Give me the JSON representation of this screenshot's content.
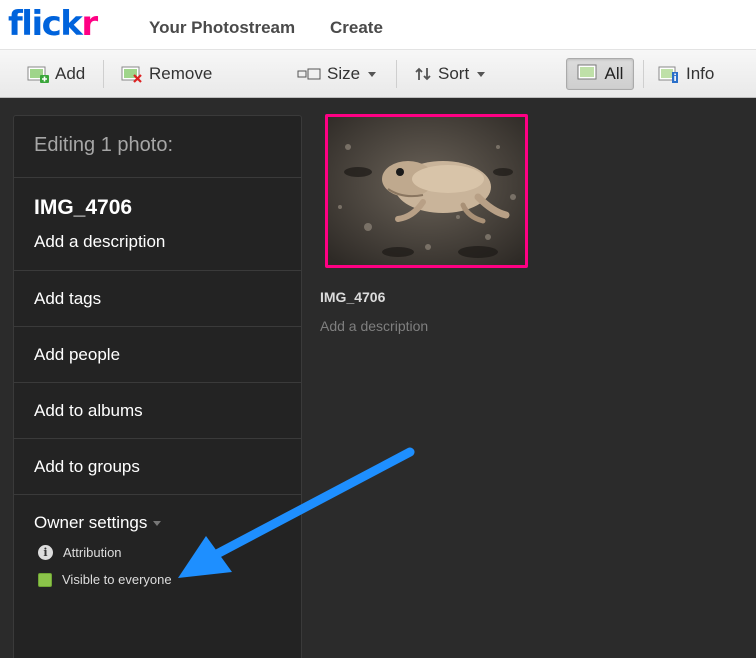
{
  "header": {
    "logo_part1": "flick",
    "logo_part2": "r",
    "nav": [
      "Your Photostream",
      "Create"
    ]
  },
  "toolbar": {
    "add_label": "Add",
    "remove_label": "Remove",
    "size_label": "Size",
    "sort_label": "Sort",
    "all_label": "All",
    "info_label": "Info"
  },
  "panel": {
    "heading": "Editing 1 photo:",
    "photo_title": "IMG_4706",
    "description_prompt": "Add a description",
    "rows": [
      "Add tags",
      "Add people",
      "Add to albums",
      "Add to groups"
    ],
    "owner_settings_label": "Owner settings",
    "settings": {
      "attribution": "Attribution",
      "visibility": "Visible to everyone"
    }
  },
  "photo": {
    "title": "IMG_4706",
    "description_prompt": "Add a description",
    "selected_border_color": "#ff0084"
  },
  "colors": {
    "flickr_blue": "#0063dc",
    "flickr_pink": "#ff0084",
    "annotation_arrow": "#1e90ff",
    "visibility_green": "#8bc34a"
  }
}
